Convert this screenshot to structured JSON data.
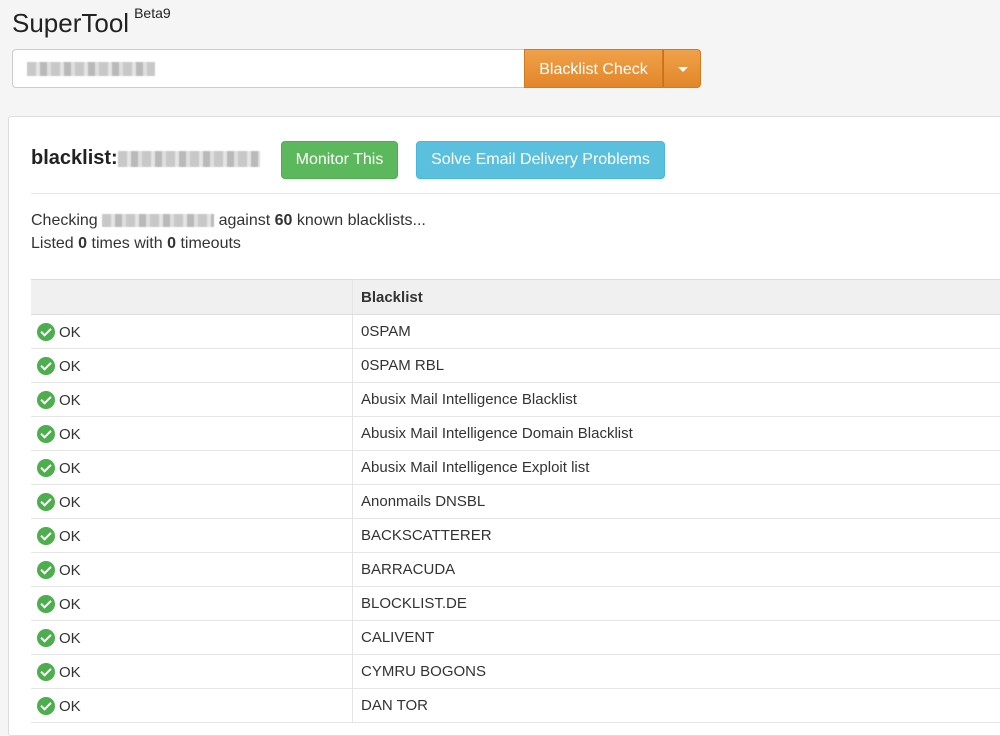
{
  "header": {
    "brand": "SuperTool",
    "version": "Beta9",
    "check_button": "Blacklist Check"
  },
  "panel": {
    "title": "blacklist:",
    "monitor_button": "Monitor This",
    "solve_button": "Solve Email Delivery Problems",
    "checking_prefix": "Checking",
    "checking_mid": "against",
    "blacklist_count": "60",
    "checking_suffix": "known blacklists...",
    "listed_prefix": "Listed",
    "listed_count": "0",
    "listed_mid": "times with",
    "timeout_count": "0",
    "listed_suffix": "timeouts"
  },
  "table": {
    "headers": [
      "",
      "Blacklist"
    ],
    "rows": [
      {
        "status": "OK",
        "name": "0SPAM"
      },
      {
        "status": "OK",
        "name": "0SPAM RBL"
      },
      {
        "status": "OK",
        "name": "Abusix Mail Intelligence Blacklist"
      },
      {
        "status": "OK",
        "name": "Abusix Mail Intelligence Domain Blacklist"
      },
      {
        "status": "OK",
        "name": "Abusix Mail Intelligence Exploit list"
      },
      {
        "status": "OK",
        "name": "Anonmails DNSBL"
      },
      {
        "status": "OK",
        "name": "BACKSCATTERER"
      },
      {
        "status": "OK",
        "name": "BARRACUDA"
      },
      {
        "status": "OK",
        "name": "BLOCKLIST.DE"
      },
      {
        "status": "OK",
        "name": "CALIVENT"
      },
      {
        "status": "OK",
        "name": "CYMRU BOGONS"
      },
      {
        "status": "OK",
        "name": "DAN TOR"
      }
    ]
  },
  "colors": {
    "accent_orange": "#e8912f",
    "success_green": "#5cb85c",
    "info_blue": "#5bc0de"
  }
}
